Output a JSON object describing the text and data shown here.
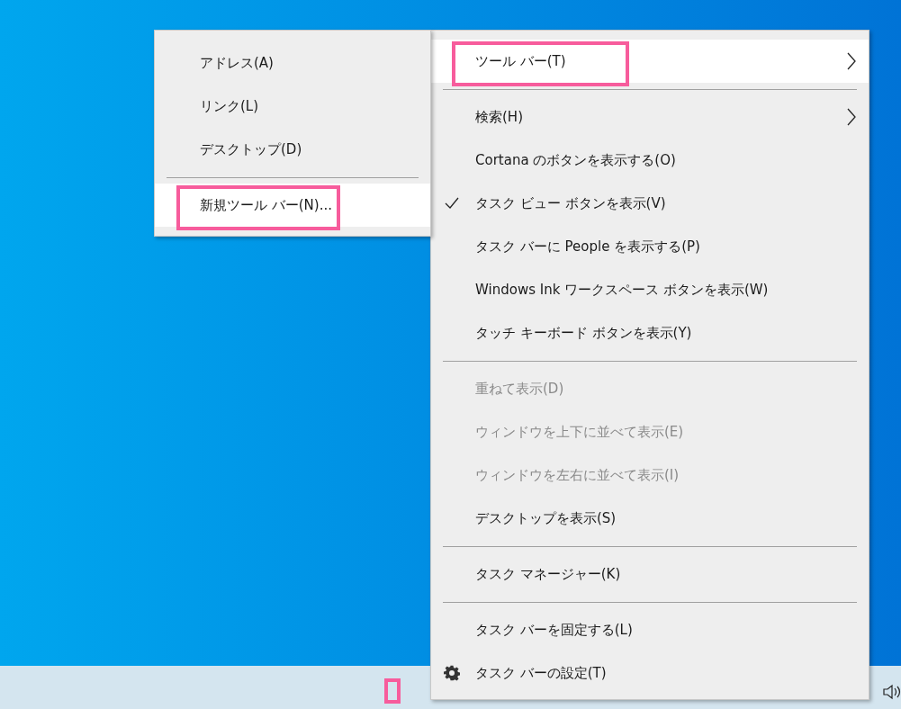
{
  "main_menu": [
    {
      "kind": "item",
      "label": "ツール バー(T)",
      "submenu": true,
      "selected": true,
      "highlighted": true,
      "checked": false,
      "disabled": false
    },
    {
      "kind": "separator"
    },
    {
      "kind": "item",
      "label": "検索(H)",
      "submenu": true,
      "selected": false,
      "highlighted": false,
      "checked": false,
      "disabled": false
    },
    {
      "kind": "item",
      "label": "Cortana のボタンを表示する(O)",
      "submenu": false,
      "selected": false,
      "highlighted": false,
      "checked": false,
      "disabled": false
    },
    {
      "kind": "item",
      "label": "タスク ビュー ボタンを表示(V)",
      "submenu": false,
      "selected": false,
      "highlighted": false,
      "checked": true,
      "disabled": false
    },
    {
      "kind": "item",
      "label": "タスク バーに People を表示する(P)",
      "submenu": false,
      "selected": false,
      "highlighted": false,
      "checked": false,
      "disabled": false
    },
    {
      "kind": "item",
      "label": "Windows Ink ワークスペース ボタンを表示(W)",
      "submenu": false,
      "selected": false,
      "highlighted": false,
      "checked": false,
      "disabled": false
    },
    {
      "kind": "item",
      "label": "タッチ キーボード ボタンを表示(Y)",
      "submenu": false,
      "selected": false,
      "highlighted": false,
      "checked": false,
      "disabled": false
    },
    {
      "kind": "separator"
    },
    {
      "kind": "item",
      "label": "重ねて表示(D)",
      "submenu": false,
      "selected": false,
      "highlighted": false,
      "checked": false,
      "disabled": true
    },
    {
      "kind": "item",
      "label": "ウィンドウを上下に並べて表示(E)",
      "submenu": false,
      "selected": false,
      "highlighted": false,
      "checked": false,
      "disabled": true
    },
    {
      "kind": "item",
      "label": "ウィンドウを左右に並べて表示(I)",
      "submenu": false,
      "selected": false,
      "highlighted": false,
      "checked": false,
      "disabled": true
    },
    {
      "kind": "item",
      "label": "デスクトップを表示(S)",
      "submenu": false,
      "selected": false,
      "highlighted": false,
      "checked": false,
      "disabled": false
    },
    {
      "kind": "separator"
    },
    {
      "kind": "item",
      "label": "タスク マネージャー(K)",
      "submenu": false,
      "selected": false,
      "highlighted": false,
      "checked": false,
      "disabled": false
    },
    {
      "kind": "separator"
    },
    {
      "kind": "item",
      "label": "タスク バーを固定する(L)",
      "submenu": false,
      "selected": false,
      "highlighted": false,
      "checked": false,
      "disabled": false
    },
    {
      "kind": "gear_item",
      "label": "タスク バーの設定(T)",
      "submenu": false,
      "selected": false,
      "highlighted": false,
      "checked": false,
      "disabled": false
    }
  ],
  "toolbar_submenu": [
    {
      "kind": "item",
      "label": "アドレス(A)",
      "selected": false,
      "highlighted": false
    },
    {
      "kind": "item",
      "label": "リンク(L)",
      "selected": false,
      "highlighted": false
    },
    {
      "kind": "item",
      "label": "デスクトップ(D)",
      "selected": false,
      "highlighted": false
    },
    {
      "kind": "separator"
    },
    {
      "kind": "item",
      "label": "新規ツール バー(N)...",
      "selected": true,
      "highlighted": true
    }
  ],
  "taskbar": {
    "highlight_mark": true
  }
}
